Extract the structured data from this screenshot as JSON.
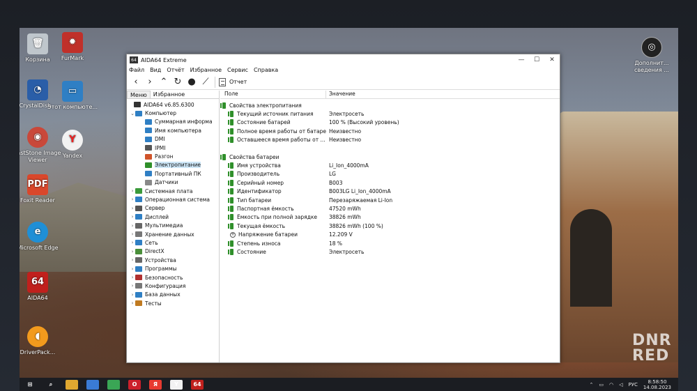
{
  "desktop": {
    "icons": [
      {
        "label": "Корзина"
      },
      {
        "label": "FurMark"
      },
      {
        "label": "CrystalDisk..."
      },
      {
        "label": "Этот компьюте..."
      },
      {
        "label": "FastStone Image Viewer"
      },
      {
        "label": "Yandex"
      },
      {
        "label": "Foxit Reader"
      },
      {
        "label": "Microsoft Edge"
      },
      {
        "label": "AIDA64"
      },
      {
        "label": "DriverPack..."
      }
    ],
    "right_icon_label": "Дополнит... сведения ...",
    "icon_colors": {
      "furmark": "#c0302a",
      "yandex": "#f2f2f2",
      "foxit": "#d9472b",
      "edge": "#1f8fd6",
      "aida": "#c0201d"
    }
  },
  "window": {
    "title": "AIDA64 Extreme",
    "logo": "64",
    "buttons": {
      "minimize": "—",
      "maximize": "☐",
      "close": "✕"
    }
  },
  "menu": [
    "Файл",
    "Вид",
    "Отчёт",
    "Избранное",
    "Сервис",
    "Справка"
  ],
  "toolbar": {
    "report_label": "Отчет"
  },
  "tabs": [
    "Меню",
    "Избранное"
  ],
  "tree": [
    {
      "label": "AIDA64 v6.85.6300",
      "level": 0,
      "expander": "",
      "color": "#333"
    },
    {
      "label": "Компьютер",
      "level": 1,
      "expander": "⌄",
      "color": "#2f7fc4"
    },
    {
      "label": "Суммарная информа",
      "level": 2,
      "expander": "",
      "color": "#2f7fc4"
    },
    {
      "label": "Имя компьютера",
      "level": 2,
      "expander": "",
      "color": "#2f7fc4"
    },
    {
      "label": "DMI",
      "level": 2,
      "expander": "",
      "color": "#2f7fc4"
    },
    {
      "label": "IPMI",
      "level": 2,
      "expander": "",
      "color": "#555"
    },
    {
      "label": "Разгон",
      "level": 2,
      "expander": "",
      "color": "#d0542a"
    },
    {
      "label": "Электропитание",
      "level": 2,
      "expander": "",
      "color": "#2f8f2a",
      "selected": true
    },
    {
      "label": "Портативный ПК",
      "level": 2,
      "expander": "",
      "color": "#2f7fc4"
    },
    {
      "label": "Датчики",
      "level": 2,
      "expander": "",
      "color": "#888"
    },
    {
      "label": "Системная плата",
      "level": 1,
      "expander": "›",
      "color": "#3a9a3a"
    },
    {
      "label": "Операционная система",
      "level": 1,
      "expander": "›",
      "color": "#2f7fc4"
    },
    {
      "label": "Сервер",
      "level": 1,
      "expander": "›",
      "color": "#555"
    },
    {
      "label": "Дисплей",
      "level": 1,
      "expander": "›",
      "color": "#2f7fc4"
    },
    {
      "label": "Мультимедиа",
      "level": 1,
      "expander": "›",
      "color": "#666"
    },
    {
      "label": "Хранение данных",
      "level": 1,
      "expander": "›",
      "color": "#777"
    },
    {
      "label": "Сеть",
      "level": 1,
      "expander": "›",
      "color": "#2f7fc4"
    },
    {
      "label": "DirectX",
      "level": 1,
      "expander": "›",
      "color": "#4a8f3a"
    },
    {
      "label": "Устройства",
      "level": 1,
      "expander": "›",
      "color": "#666"
    },
    {
      "label": "Программы",
      "level": 1,
      "expander": "›",
      "color": "#2f7fc4"
    },
    {
      "label": "Безопасность",
      "level": 1,
      "expander": "›",
      "color": "#b03030"
    },
    {
      "label": "Конфигурация",
      "level": 1,
      "expander": "›",
      "color": "#777"
    },
    {
      "label": "База данных",
      "level": 1,
      "expander": "›",
      "color": "#2f7fc4"
    },
    {
      "label": "Тесты",
      "level": 1,
      "expander": "›",
      "color": "#c07a20"
    }
  ],
  "columns": {
    "field": "Поле",
    "value": "Значение"
  },
  "sections": [
    {
      "title": "Свойства электропитания",
      "rows": [
        {
          "field": "Текущий источник питания",
          "value": "Электросеть",
          "icon": "battery"
        },
        {
          "field": "Состояние батарей",
          "value": "100 % (Высокий уровень)",
          "icon": "battery"
        },
        {
          "field": "Полное время работы от батаре...",
          "value": "Неизвестно",
          "icon": "battery"
        },
        {
          "field": "Оставшееся время работы от ...",
          "value": "Неизвестно",
          "icon": "battery"
        }
      ]
    },
    {
      "title": "Свойства батареи",
      "rows": [
        {
          "field": "Имя устройства",
          "value": "Li_Ion_4000mA",
          "icon": "battery"
        },
        {
          "field": "Производитель",
          "value": "LG",
          "icon": "battery"
        },
        {
          "field": "Серийный номер",
          "value": "B003",
          "icon": "battery"
        },
        {
          "field": "Идентификатор",
          "value": "B003LG Li_Ion_4000mA",
          "icon": "battery"
        },
        {
          "field": "Тип батареи",
          "value": "Перезаряжаемая Li-Ion",
          "icon": "battery"
        },
        {
          "field": "Паспортная ёмкость",
          "value": "47520 mWh",
          "icon": "battery"
        },
        {
          "field": "Ёмкость при полной зарядке",
          "value": "38826 mWh",
          "icon": "battery"
        },
        {
          "field": "Текущая ёмкость",
          "value": "38826 mWh  (100 %)",
          "icon": "battery"
        },
        {
          "field": "Напряжение батареи",
          "value": "12.209 V",
          "icon": "voltage"
        },
        {
          "field": "Степень износа",
          "value": "18 %",
          "icon": "battery"
        },
        {
          "field": "Состояние",
          "value": "Электросеть",
          "icon": "battery"
        }
      ]
    }
  ],
  "taskbar": {
    "items": [
      {
        "name": "start",
        "glyph": "⊞",
        "color": "transparent"
      },
      {
        "name": "search",
        "glyph": "⌕",
        "color": "transparent"
      },
      {
        "name": "files",
        "glyph": "",
        "color": "#e0a830"
      },
      {
        "name": "store",
        "glyph": "",
        "color": "#3a7bd5"
      },
      {
        "name": "chrome",
        "glyph": "",
        "color": "#3aa655"
      },
      {
        "name": "opera",
        "glyph": "O",
        "color": "#cc1f2b"
      },
      {
        "name": "yandex-browser",
        "glyph": "Я",
        "color": "#e83a30"
      },
      {
        "name": "yandex",
        "glyph": "Y",
        "color": "#f2f2f2"
      },
      {
        "name": "aida64",
        "glyph": "64",
        "color": "#c0201d"
      }
    ],
    "lang": "РУС",
    "time": "8:58:50",
    "date": "14.08.2023"
  },
  "watermark": {
    "line1": "DNR",
    "line2": "RED"
  }
}
